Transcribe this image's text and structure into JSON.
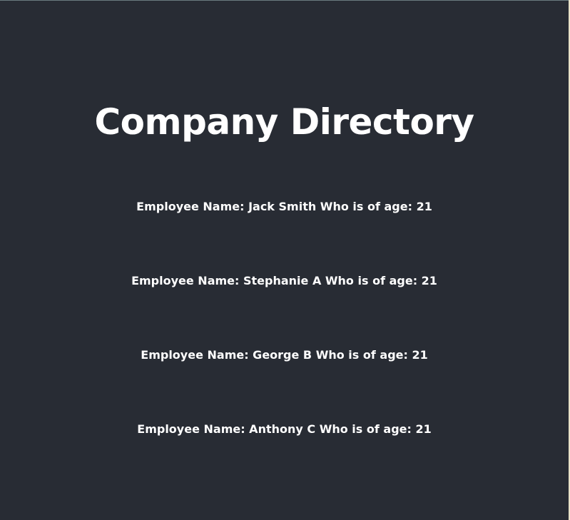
{
  "page": {
    "title": "Company Directory",
    "colors": {
      "background": "#282c34",
      "text": "#ffffff"
    }
  },
  "employees": [
    {
      "text": "Employee Name: Jack Smith Who is of age: 21"
    },
    {
      "text": "Employee Name: Stephanie A Who is of age: 21"
    },
    {
      "text": "Employee Name: George B Who is of age: 21"
    },
    {
      "text": "Employee Name: Anthony C Who is of age: 21"
    }
  ]
}
